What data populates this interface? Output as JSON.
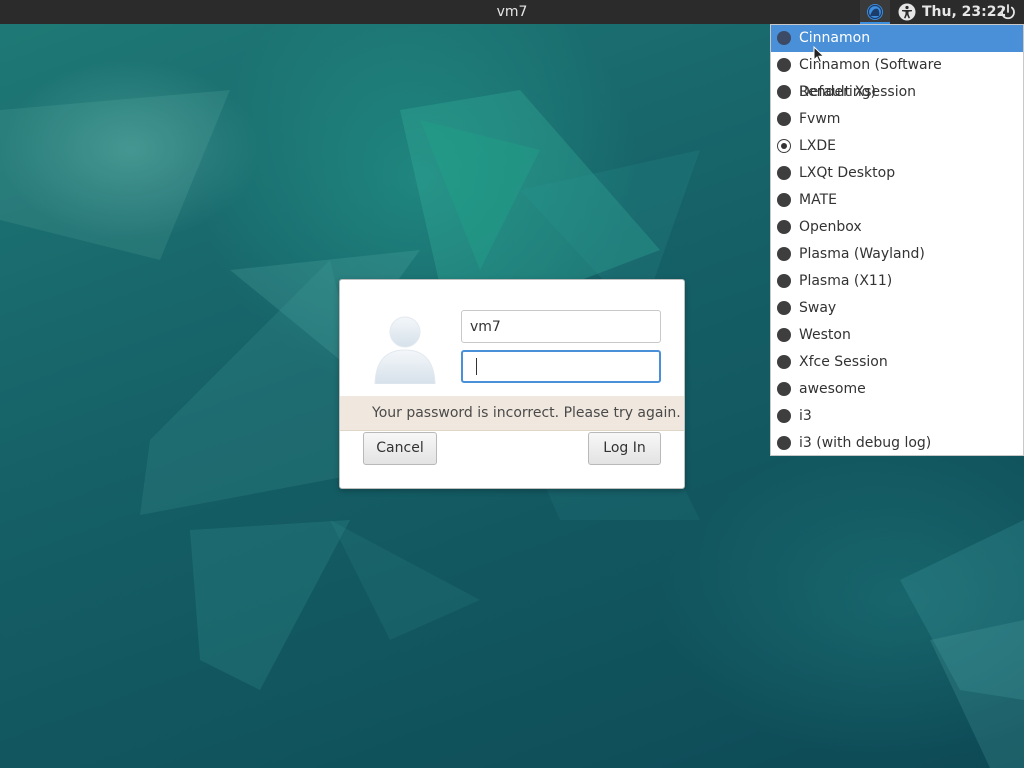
{
  "top_panel": {
    "hostname": "vm7",
    "clock": "Thu, 23:22",
    "icons": {
      "session": "session-indicator-icon",
      "accessibility": "accessibility-icon",
      "power": "power-icon"
    }
  },
  "session_menu": {
    "items": [
      {
        "label": "Cinnamon",
        "highlighted": true,
        "checked": false
      },
      {
        "label": "Cinnamon (Software Rendering)",
        "highlighted": false,
        "checked": false
      },
      {
        "label": "Default Xsession",
        "highlighted": false,
        "checked": false
      },
      {
        "label": "Fvwm",
        "highlighted": false,
        "checked": false
      },
      {
        "label": "LXDE",
        "highlighted": false,
        "checked": true
      },
      {
        "label": "LXQt Desktop",
        "highlighted": false,
        "checked": false
      },
      {
        "label": "MATE",
        "highlighted": false,
        "checked": false
      },
      {
        "label": "Openbox",
        "highlighted": false,
        "checked": false
      },
      {
        "label": "Plasma (Wayland)",
        "highlighted": false,
        "checked": false
      },
      {
        "label": "Plasma (X11)",
        "highlighted": false,
        "checked": false
      },
      {
        "label": "Sway",
        "highlighted": false,
        "checked": false
      },
      {
        "label": "Weston",
        "highlighted": false,
        "checked": false
      },
      {
        "label": "Xfce Session",
        "highlighted": false,
        "checked": false
      },
      {
        "label": "awesome",
        "highlighted": false,
        "checked": false
      },
      {
        "label": "i3",
        "highlighted": false,
        "checked": false
      },
      {
        "label": "i3 (with debug log)",
        "highlighted": false,
        "checked": false
      }
    ]
  },
  "login_dialog": {
    "username_value": "vm7",
    "password_value": "",
    "error_message": "Your password is incorrect. Please try again.",
    "cancel_label": "Cancel",
    "login_label": "Log In",
    "avatar_icon": "user-avatar-icon"
  },
  "colors": {
    "accent": "#4a90d9",
    "panel_bg": "#2b2b2b",
    "error_bg": "#f0e8de",
    "desktop_teal": "#155f66"
  }
}
